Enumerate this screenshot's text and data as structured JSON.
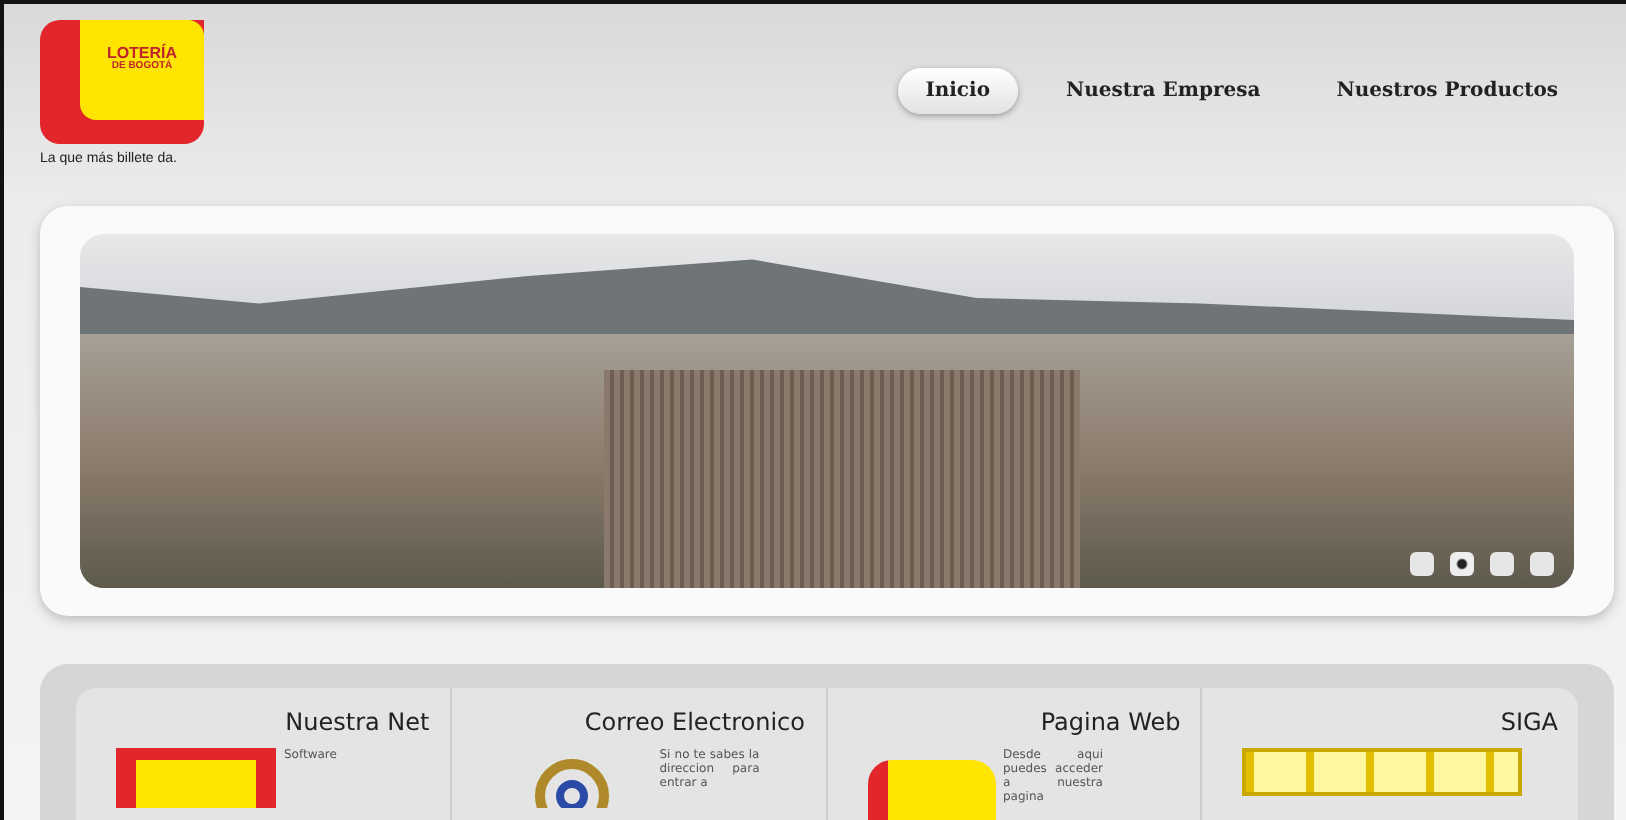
{
  "logo": {
    "line_1": "LOTERÍA",
    "line_2": "DE BOGOTÁ",
    "tagline": "La que más billete da."
  },
  "nav": [
    {
      "label": "Inicio",
      "selected": true
    },
    {
      "label": "Nuestra Empresa",
      "selected": false
    },
    {
      "label": "Nuestros Productos",
      "selected": false
    }
  ],
  "slider": {
    "dots": [
      {
        "selected": false
      },
      {
        "selected": true
      },
      {
        "selected": false
      },
      {
        "selected": false
      }
    ]
  },
  "sections": [
    {
      "title": "Nuestra Net",
      "kind": "net",
      "text": "Software"
    },
    {
      "title": "Correo Electronico",
      "kind": "mail",
      "text": "Si no te sabes la direccion para entrar a"
    },
    {
      "title": "Pagina Web",
      "kind": "web",
      "text": "Desde aqui puedes acceder a nuestra pagina"
    },
    {
      "title": "SIGA",
      "kind": "siga"
    }
  ]
}
